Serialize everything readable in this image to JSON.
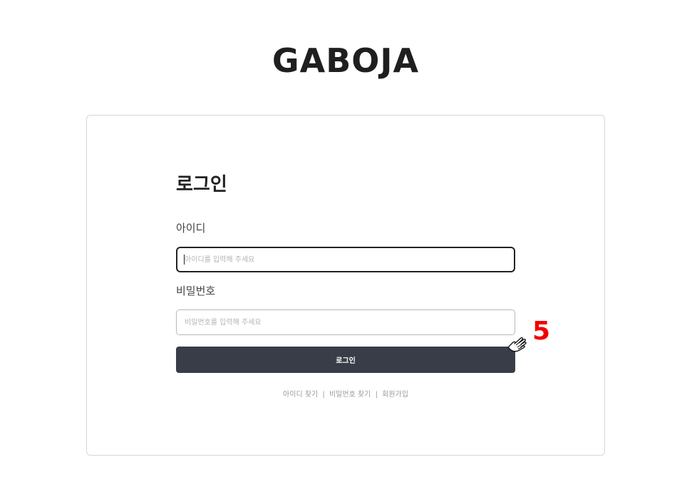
{
  "brand": {
    "logo_text": "GABOJA"
  },
  "login": {
    "title": "로그인",
    "id_label": "아이디",
    "id_placeholder": "아이디를 입력해 주세요",
    "pw_label": "비밀번호",
    "pw_placeholder": "비밀번호를 입력해 주세요",
    "submit_label": "로그인"
  },
  "links": {
    "find_id": "아이디 찾기",
    "separator": "|",
    "find_pw": "비밀번호 찾기",
    "signup": "회원가입"
  },
  "annotation": {
    "step_number": "5",
    "color": "#f20000"
  },
  "colors": {
    "button_bg": "#393d47",
    "logo": "#1f1f1f"
  }
}
